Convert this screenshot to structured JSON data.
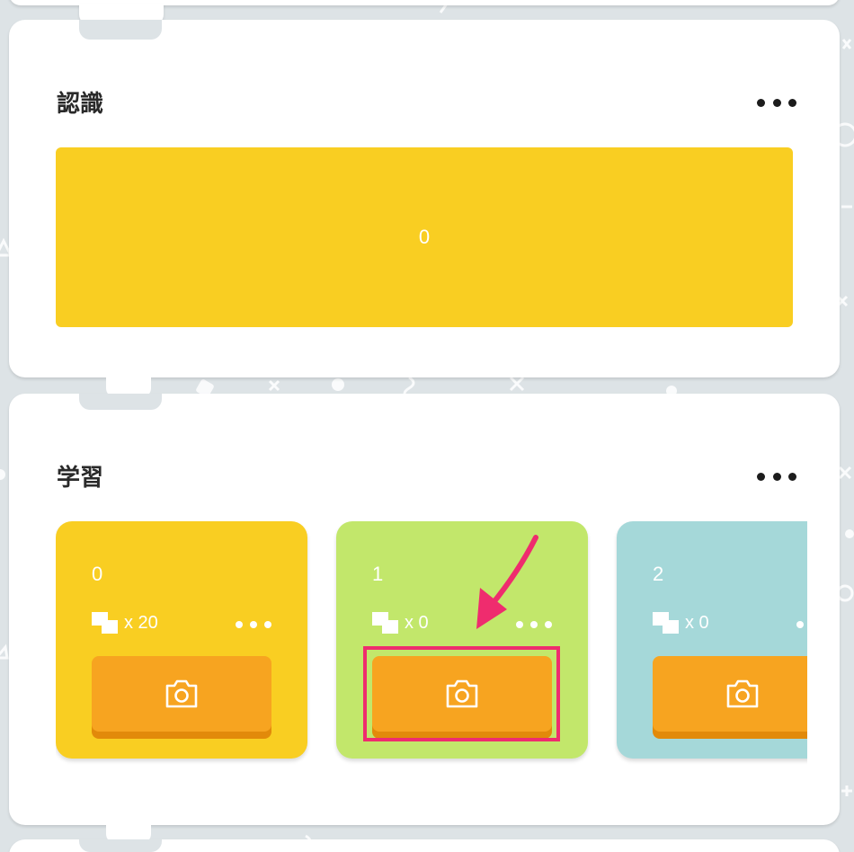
{
  "panels": {
    "recognition": {
      "title": "認識",
      "result_value": "0",
      "result_color": "#f9ce22"
    },
    "training": {
      "title": "学習",
      "classes": [
        {
          "label": "0",
          "samples": "x 20",
          "color": "#f9ce22"
        },
        {
          "label": "1",
          "samples": "x 0",
          "color": "#c2e76b"
        },
        {
          "label": "2",
          "samples": "x 0",
          "color": "#a5d8d9"
        }
      ]
    }
  },
  "icons": {
    "more": "more-horizontal-icon",
    "samples": "image-stack-icon",
    "capture": "camera-icon"
  },
  "colors": {
    "button": "#f7a420",
    "button_shadow": "#e28a0a",
    "annotation": "#ef2c6e",
    "background": "#dde3e6"
  }
}
